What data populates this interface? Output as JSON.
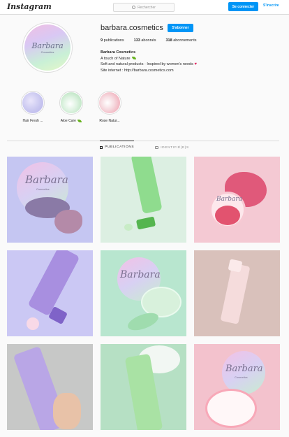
{
  "header": {
    "logo": "Instagram",
    "search_placeholder": "Rechercher",
    "login_label": "Se connecter",
    "signup_label": "S'inscrire",
    "accent_color": "#0095f6"
  },
  "profile": {
    "username": "barbara.cosmetics",
    "follow_label": "S'abonner",
    "avatar_brand": "Barbara",
    "avatar_sub": "Cosmetics",
    "stats": [
      {
        "count": "9",
        "label": "publications"
      },
      {
        "count": "133",
        "label": "abonnés"
      },
      {
        "count": "318",
        "label": "abonnements"
      }
    ],
    "bio": {
      "name": "Barbara Cosmetics",
      "line1": "A touch of Nature",
      "line2": "Soft and natural products · Inspired by women's needs",
      "line3": "Site internet : http://barbara.cosmetics.com"
    }
  },
  "highlights": [
    {
      "label": "Hair Fresh ...",
      "color": "#c9c7f0"
    },
    {
      "label": "Aloe Care",
      "color": "#bfe6c4"
    },
    {
      "label": "Rose Natur...",
      "color": "#f2c7cf"
    }
  ],
  "tabs": [
    {
      "label": "PUBLICATIONS",
      "icon": "grid-icon"
    },
    {
      "label": "IDENTIFIÉ(E)S",
      "icon": "tag-icon"
    }
  ],
  "posts": {
    "brand": "Barbara",
    "sub": "Cosmetics"
  }
}
